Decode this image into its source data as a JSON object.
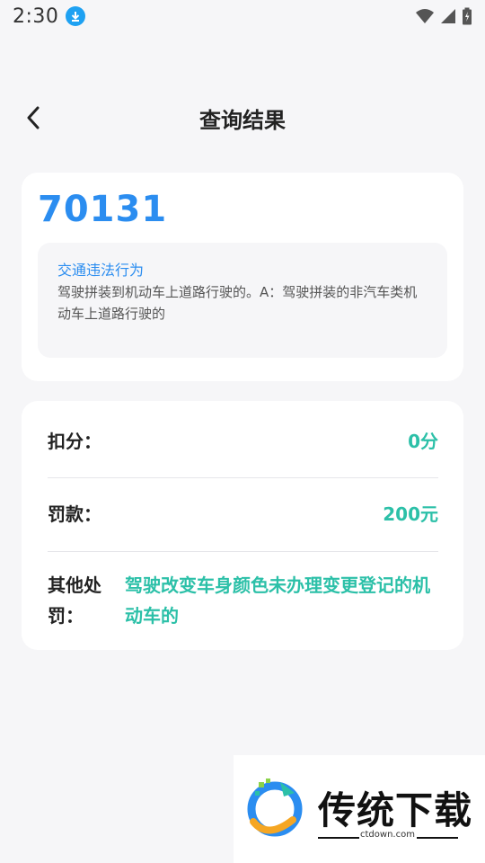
{
  "status_bar": {
    "time": "2:30",
    "icons": [
      "download-icon",
      "wifi-icon",
      "signal-icon",
      "battery-icon"
    ]
  },
  "header": {
    "title": "查询结果",
    "back_icon": "chevron-left-icon"
  },
  "result": {
    "code": "70131",
    "violation_label": "交通违法行为",
    "violation_text": "驾驶拼装到机动车上道路行驶的。A：驾驶拼装的非汽车类机动车上道路行驶的"
  },
  "penalty": {
    "points_label": "扣分：",
    "points_value": "0分",
    "fine_label": "罚款：",
    "fine_value": "200元",
    "other_label": "其他处罚：",
    "other_value": "驾驶改变车身颜色未办理变更登记的机动车的"
  },
  "watermark": {
    "brand": "传统下载",
    "url": "ctdown.com"
  },
  "colors": {
    "accent_blue": "#2b8df0",
    "accent_teal": "#2cc0a8",
    "background": "#f6f6f8"
  }
}
